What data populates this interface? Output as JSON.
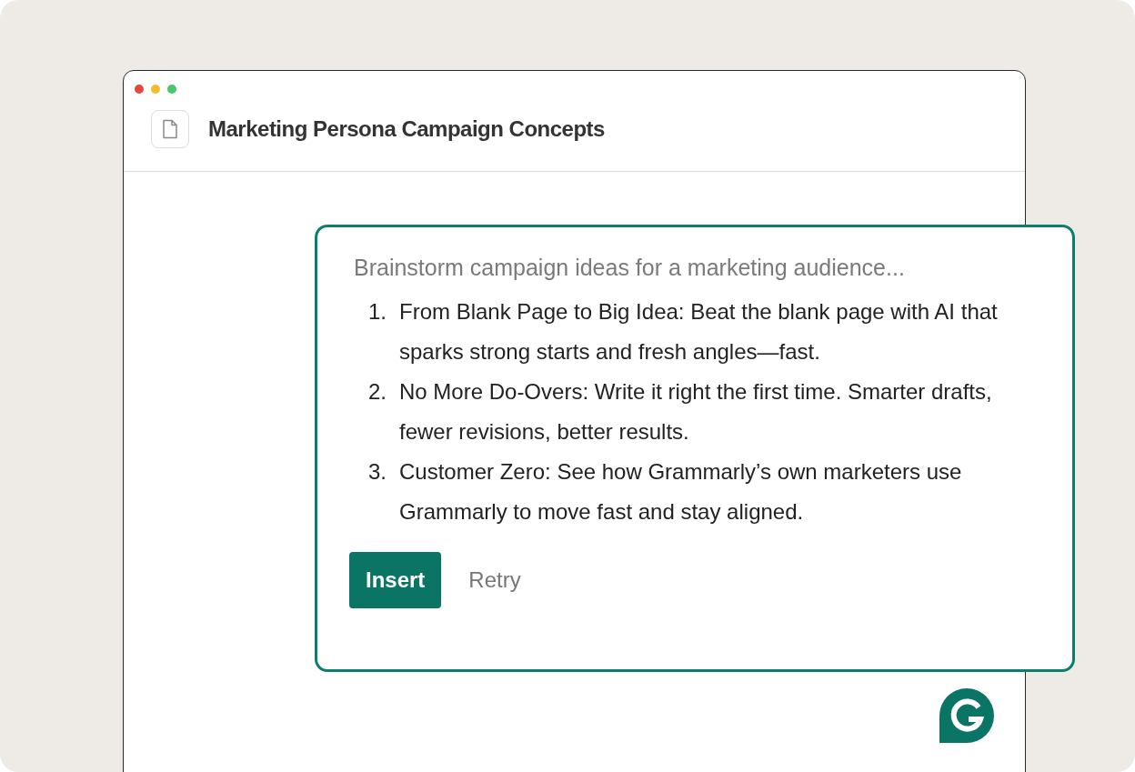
{
  "window": {
    "controls": [
      {
        "color": "#e5483f"
      },
      {
        "color": "#f4bd2f"
      },
      {
        "color": "#45c969"
      }
    ],
    "title": "Marketing Persona Campaign Concepts"
  },
  "suggestion": {
    "prompt": "Brainstorm campaign ideas for a marketing audience...",
    "ideas": [
      {
        "number": "1.",
        "text": "From Blank Page to Big Idea: Beat the blank page with AI that sparks strong starts and fresh angles—fast."
      },
      {
        "number": "2.",
        "text": "No More Do-Overs: Write it right the first time. Smarter drafts, fewer revisions, better results."
      },
      {
        "number": "3.",
        "text": "Customer Zero: See how Grammarly’s own marketers use Grammarly to move fast and stay aligned."
      }
    ],
    "buttons": [
      {
        "label": "Insert",
        "kind": "primary"
      },
      {
        "label": "Retry",
        "kind": "text"
      }
    ]
  }
}
